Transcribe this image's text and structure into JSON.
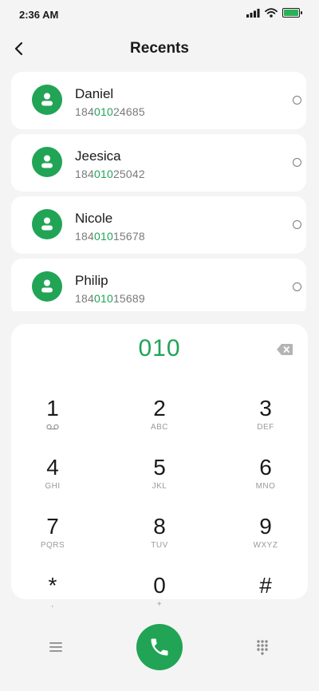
{
  "status_bar": {
    "time": "2:36 AM"
  },
  "header": {
    "title": "Recents"
  },
  "contacts": [
    {
      "name": "Daniel",
      "num_pre": "184",
      "num_match": "010",
      "num_post": "24685"
    },
    {
      "name": "Jeesica",
      "num_pre": "184",
      "num_match": "010",
      "num_post": "25042"
    },
    {
      "name": "Nicole",
      "num_pre": "184",
      "num_match": "010",
      "num_post": "15678"
    },
    {
      "name": "Philip",
      "num_pre": "184",
      "num_match": "010",
      "num_post": "15689"
    }
  ],
  "dialer": {
    "input": "010",
    "keys": [
      {
        "digit": "1",
        "letters": ""
      },
      {
        "digit": "2",
        "letters": "ABC"
      },
      {
        "digit": "3",
        "letters": "DEF"
      },
      {
        "digit": "4",
        "letters": "GHI"
      },
      {
        "digit": "5",
        "letters": "JKL"
      },
      {
        "digit": "6",
        "letters": "MNO"
      },
      {
        "digit": "7",
        "letters": "PQRS"
      },
      {
        "digit": "8",
        "letters": "TUV"
      },
      {
        "digit": "9",
        "letters": "WXYZ"
      },
      {
        "digit": "*",
        "letters": ","
      },
      {
        "digit": "0",
        "letters": "+"
      },
      {
        "digit": "#",
        "letters": ""
      }
    ]
  },
  "icons": {
    "back": "chevron-left-icon",
    "backspace": "backspace-icon",
    "voicemail": "voicemail-icon",
    "menu": "menu-icon",
    "call": "phone-icon",
    "dialpad": "dialpad-icon"
  },
  "colors": {
    "accent": "#21a455",
    "background": "#f4f4f4",
    "card": "#ffffff"
  }
}
